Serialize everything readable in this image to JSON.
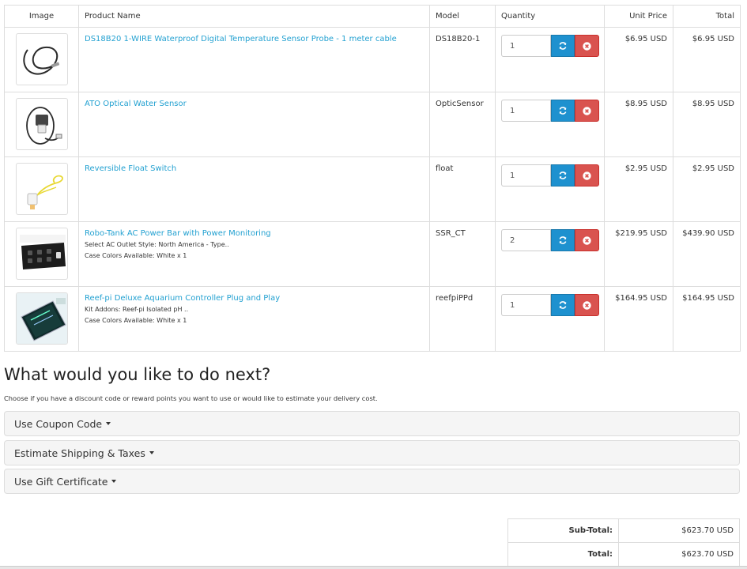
{
  "headers": {
    "image": "Image",
    "name": "Product Name",
    "model": "Model",
    "quantity": "Quantity",
    "unit_price": "Unit Price",
    "total": "Total"
  },
  "items": [
    {
      "name": "DS18B20 1-WIRE Waterproof Digital Temperature Sensor Probe - 1 meter cable",
      "options": [],
      "model": "DS18B20-1",
      "quantity": "1",
      "unit_price": "$6.95 USD",
      "total": "$6.95 USD"
    },
    {
      "name": "ATO Optical Water Sensor",
      "options": [],
      "model": "OpticSensor",
      "quantity": "1",
      "unit_price": "$8.95 USD",
      "total": "$8.95 USD"
    },
    {
      "name": "Reversible Float Switch",
      "options": [],
      "model": "float",
      "quantity": "1",
      "unit_price": "$2.95 USD",
      "total": "$2.95 USD"
    },
    {
      "name": "Robo-Tank AC Power Bar with Power Monitoring",
      "options": [
        "Select AC Outlet Style: North America - Type..",
        "Case Colors Available: White x 1"
      ],
      "model": "SSR_CT",
      "quantity": "2",
      "unit_price": "$219.95 USD",
      "total": "$439.90 USD"
    },
    {
      "name": "Reef-pi Deluxe Aquarium Controller Plug and Play",
      "options": [
        "Kit Addons: Reef-pi Isolated pH ..",
        "Case Colors Available: White x 1"
      ],
      "model": "reefpiPPd",
      "quantity": "1",
      "unit_price": "$164.95 USD",
      "total": "$164.95 USD"
    }
  ],
  "icons": {
    "update": "refresh-icon",
    "remove": "times-circle-icon"
  },
  "colors": {
    "link": "#23a1d1",
    "update_button": "#1e91cf",
    "remove_button": "#d9534f"
  },
  "next": {
    "heading": "What would you like to do next?",
    "subtext": "Choose if you have a discount code or reward points you want to use or would like to estimate your delivery cost."
  },
  "panels": {
    "coupon": "Use Coupon Code",
    "shipping": "Estimate Shipping & Taxes",
    "voucher": "Use Gift Certificate"
  },
  "totals": {
    "subtotal_label": "Sub-Total:",
    "subtotal_value": "$623.70 USD",
    "total_label": "Total:",
    "total_value": "$623.70 USD"
  }
}
